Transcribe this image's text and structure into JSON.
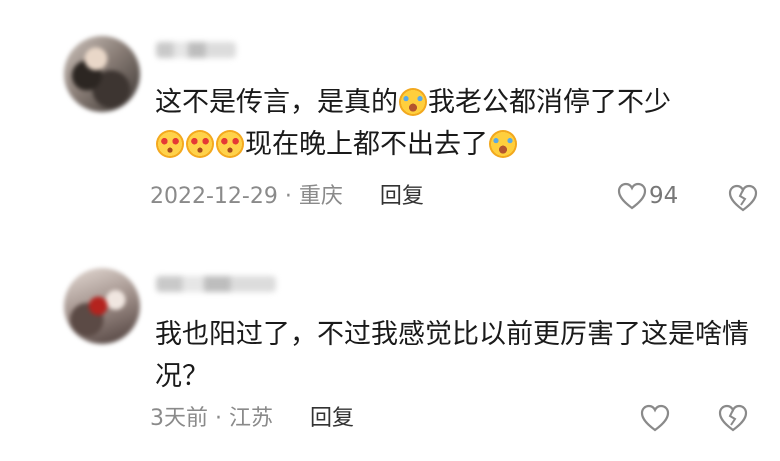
{
  "comments": [
    {
      "text_part1": "这不是传言，是真的",
      "text_part2": "我老公都消停了不少",
      "text_part3": "现在晚上都不出去了",
      "date": "2022-12-29",
      "separator": "·",
      "location": "重庆",
      "reply_label": "回复",
      "likes": "94",
      "emojis": [
        "laughing-tears-icon",
        "heart-eyes-icon"
      ]
    },
    {
      "text": "我也阳过了，不过我感觉比以前更厉害了这是啥情况？",
      "date": "3天前",
      "separator": "·",
      "location": "江苏",
      "reply_label": "回复",
      "likes": ""
    }
  ],
  "colors": {
    "text": "#1a1a1a",
    "meta": "#8a8a8a",
    "reply": "#333333",
    "laugh_emoji": "#ffcf3d",
    "heart": "#e53935"
  }
}
